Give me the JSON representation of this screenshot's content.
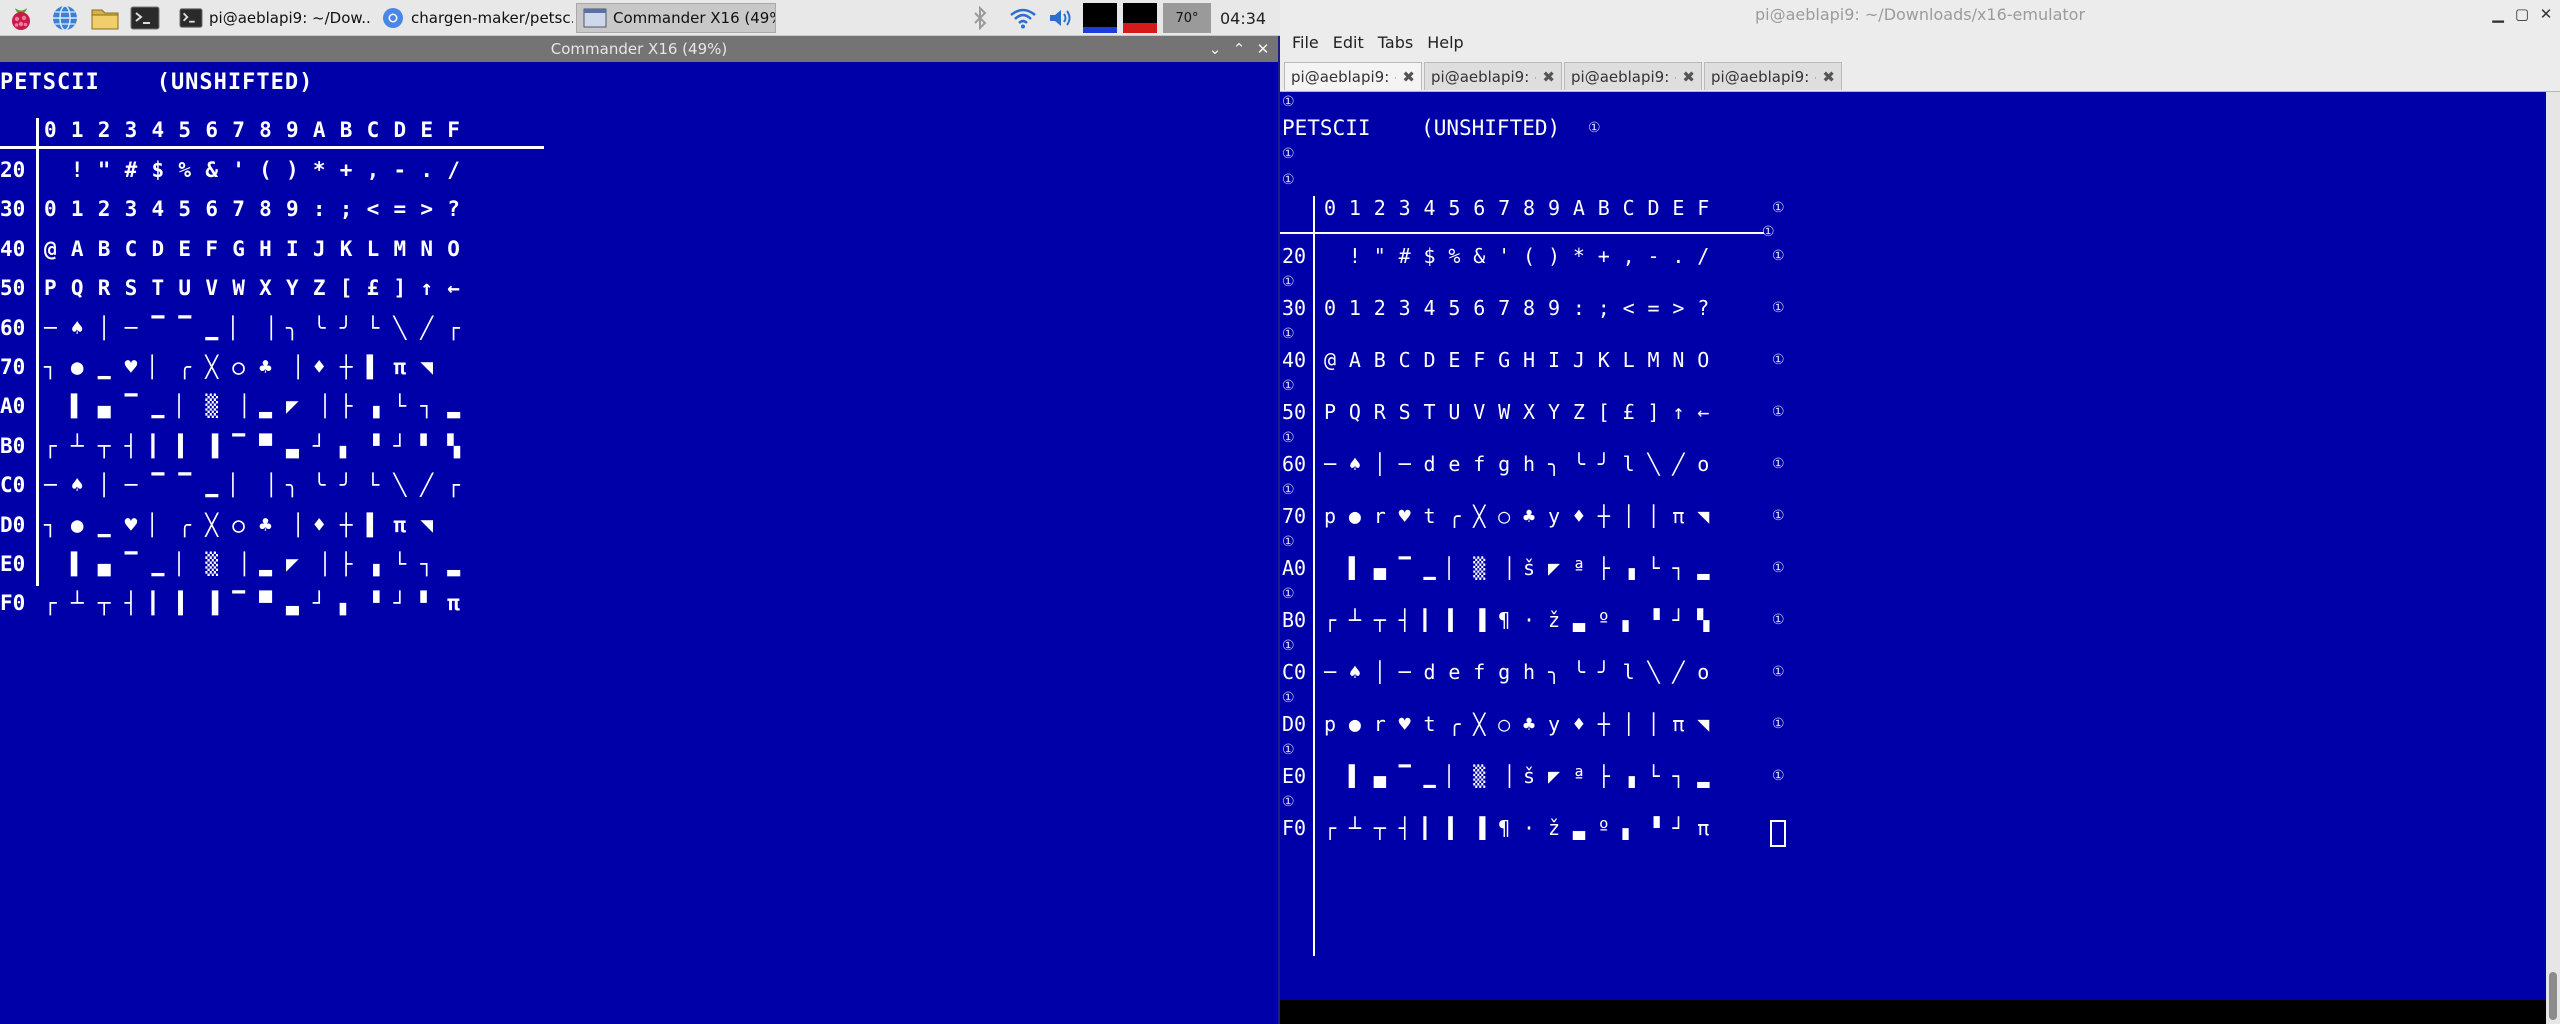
{
  "panel": {
    "tasks": [
      {
        "label": "pi@aeblapi9: ~/Dow..."
      },
      {
        "label": "chargen-maker/petsc..."
      },
      {
        "label": "Commander X16 (49%)"
      }
    ],
    "temperature": "70°",
    "clock": "04:34"
  },
  "emulator": {
    "title": "Commander X16 (49%)",
    "header": "PETSCII    (UNSHIFTED)",
    "columns": "0 1 2 3 4 5 6 7 8 9 A B C D E F",
    "rows": [
      {
        "code": "20",
        "chars": "  ! \" # $ % & ' ( ) * + , - . /"
      },
      {
        "code": "30",
        "chars": "0 1 2 3 4 5 6 7 8 9 : ; < = > ?"
      },
      {
        "code": "40",
        "chars": "@ A B C D E F G H I J K L M N O"
      },
      {
        "code": "50",
        "chars": "P Q R S T U V W X Y Z [ £ ] ↑ ←"
      },
      {
        "code": "60",
        "chars": "─ ♠ │ ─ ▔ ▔ ▁ ▏ ▕ ╮ ╰ ╯ └ ╲ ╱ ┌"
      },
      {
        "code": "70",
        "chars": "┐ ● ▁ ♥ ▏ ╭ ╳ ○ ♣ ▕ ♦ ┼ ▌ π ◥  "
      },
      {
        "code": "A0",
        "chars": "  ▌ ▄ ▔ ▁ ▏ ▒ ▕ ▂ ◤ ▕ ├ ▗ └ ┐ ▂"
      },
      {
        "code": "B0",
        "chars": "┌ ┴ ┬ ┤ ▎ ▍ ▐ ▔ ▀ ▃ ┘ ▖ ▝ ┘ ▘ ▚"
      },
      {
        "code": "C0",
        "chars": "─ ♠ │ ─ ▔ ▔ ▁ ▏ ▕ ╮ ╰ ╯ └ ╲ ╱ ┌"
      },
      {
        "code": "D0",
        "chars": "┐ ● ▁ ♥ ▏ ╭ ╳ ○ ♣ ▕ ♦ ┼ ▌ π ◥  "
      },
      {
        "code": "E0",
        "chars": "  ▌ ▄ ▔ ▁ ▏ ▒ ▕ ▂ ◤ ▕ ├ ▗ └ ┐ ▂"
      },
      {
        "code": "F0",
        "chars": "┌ ┴ ┬ ┤ ▎ ▍ ▐ ▔ ▀ ▃ ┘ ▖ ▝ ┘ ▘ π"
      }
    ]
  },
  "terminal": {
    "title": "pi@aeblapi9: ~/Downloads/x16-emulator",
    "menus": [
      "File",
      "Edit",
      "Tabs",
      "Help"
    ],
    "tabs": [
      {
        "label": "pi@aeblapi9: ~"
      },
      {
        "label": "pi@aeblapi9: ~"
      },
      {
        "label": "pi@aeblapi9: ~"
      },
      {
        "label": "pi@aeblapi9: ~"
      }
    ],
    "header": "PETSCII    (UNSHIFTED)",
    "columns": "0 1 2 3 4 5 6 7 8 9 A B C D E F",
    "rows": [
      {
        "code": "20",
        "chars": "  ! \" # $ % & ' ( ) * + , - . /"
      },
      {
        "code": "30",
        "chars": "0 1 2 3 4 5 6 7 8 9 : ; < = > ?"
      },
      {
        "code": "40",
        "chars": "@ A B C D E F G H I J K L M N O"
      },
      {
        "code": "50",
        "chars": "P Q R S T U V W X Y Z [ £ ] ↑ ←"
      },
      {
        "code": "60",
        "chars": "─ ♠ │ ─ d e f g h ╮ ╰ ╯ l ╲ ╱ o"
      },
      {
        "code": "70",
        "chars": "p ● r ♥ t ╭ ╳ ○ ♣ y ♦ ┼ │ │ π ◥"
      },
      {
        "code": "A0",
        "chars": "  ▌ ▄ ▔ ▁ ▏ ▒ ▕ š ◤ ª ├ ▗ └ ┐ ▂"
      },
      {
        "code": "B0",
        "chars": "┌ ┴ ┬ ┤ ▎ ▍ ▐ ¶ · ž ▃ º ▖ ▝ ┘ ▚"
      },
      {
        "code": "C0",
        "chars": "─ ♠ │ ─ d e f g h ╮ ╰ ╯ l ╲ ╱ o"
      },
      {
        "code": "D0",
        "chars": "p ● r ♥ t ╭ ╳ ○ ♣ y ♦ ┼ │ │ π ◥"
      },
      {
        "code": "E0",
        "chars": "  ▌ ▄ ▔ ▁ ▏ ▒ ▕ š ◤ ª ├ ▗ └ ┐ ▂"
      },
      {
        "code": "F0",
        "chars": "┌ ┴ ┬ ┤ ▎ ▍ ▐ ¶ · ž ▃ º ▖ ▝ ┘ π"
      }
    ],
    "marker": "①"
  },
  "colors": {
    "screen_blue": "#0000a8",
    "panel_bg": "#e8e8e8",
    "emu_titlebar": "#747474"
  }
}
